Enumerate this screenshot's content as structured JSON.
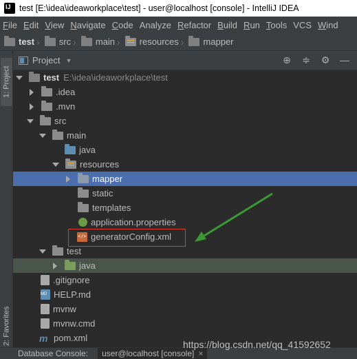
{
  "window": {
    "title": "test [E:\\idea\\ideaworkplace\\test] - user@localhost [console] - IntelliJ IDEA"
  },
  "menu": [
    {
      "mnemonic": "F",
      "rest": "ile"
    },
    {
      "mnemonic": "E",
      "rest": "dit"
    },
    {
      "mnemonic": "V",
      "rest": "iew"
    },
    {
      "mnemonic": "N",
      "rest": "avigate"
    },
    {
      "mnemonic": "C",
      "rest": "ode"
    },
    {
      "mnemonic": "",
      "rest": "Analyze"
    },
    {
      "mnemonic": "R",
      "rest": "efactor"
    },
    {
      "mnemonic": "B",
      "rest": "uild"
    },
    {
      "mnemonic": "R",
      "rest": "un"
    },
    {
      "mnemonic": "T",
      "rest": "ools"
    },
    {
      "mnemonic": "",
      "rest": "VCS"
    },
    {
      "mnemonic": "W",
      "rest": "ind"
    }
  ],
  "breadcrumbs": [
    "test",
    "src",
    "main",
    "resources",
    "mapper"
  ],
  "side_tabs": {
    "project": "1: Project",
    "favorites": "2: Favorites"
  },
  "panel": {
    "title": "Project"
  },
  "tree": {
    "root_name": "test",
    "root_path": "E:\\idea\\ideaworkplace\\test",
    "idea": ".idea",
    "mvn": ".mvn",
    "src": "src",
    "main": "main",
    "java": "java",
    "resources": "resources",
    "mapper": "mapper",
    "static": "static",
    "templates": "templates",
    "app_props": "application.properties",
    "generator": "generatorConfig.xml",
    "test": "test",
    "test_java": "java",
    "gitignore": ".gitignore",
    "help": "HELP.md",
    "mvnw": "mvnw",
    "mvnw_cmd": "mvnw.cmd",
    "pom": "pom.xml"
  },
  "bottom": {
    "label": "Database Console:",
    "tab": "user@localhost [console]",
    "close": "×"
  },
  "watermark": "https://blog.csdn.net/qq_41592652",
  "colors": {
    "selection": "#4b6eaf",
    "test_highlight": "#49544a",
    "box_border": "#e03c31",
    "annotation_arrow": "#3c9a35"
  }
}
